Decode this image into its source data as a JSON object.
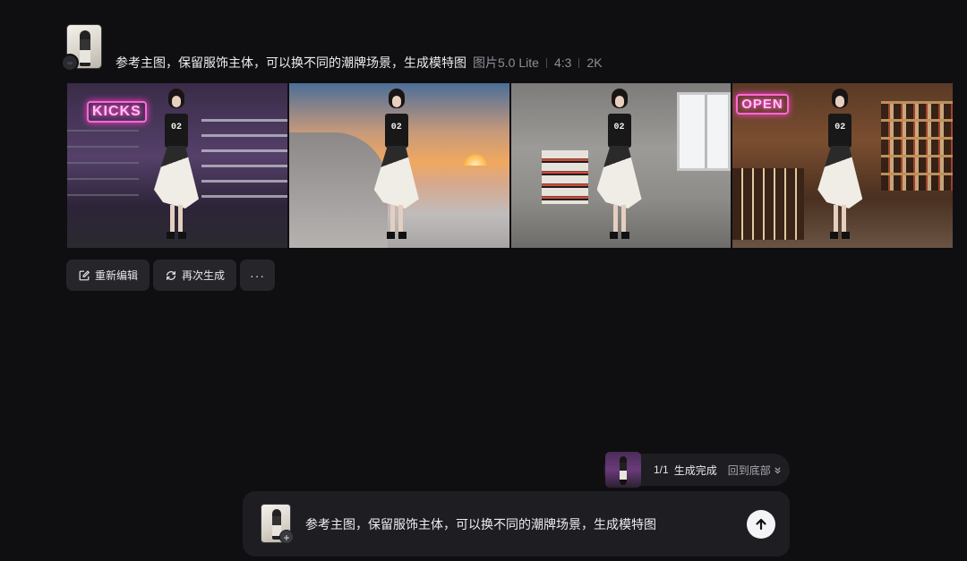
{
  "prompt": {
    "text": "参考主图，保留服饰主体，可以换不同的潮牌场景，生成模特图",
    "model": "图片5.0 Lite",
    "ratio": "4:3",
    "resolution": "2K"
  },
  "images": [
    {
      "neon_sign": "KICKS",
      "jersey": "02"
    },
    {
      "neon_sign": "",
      "jersey": "02"
    },
    {
      "neon_sign": "",
      "jersey": "02"
    },
    {
      "neon_sign": "OPEN",
      "jersey": "02"
    }
  ],
  "actions": {
    "reedit_label": "重新编辑",
    "regenerate_label": "再次生成",
    "more_label": "···"
  },
  "status": {
    "count": "1/1",
    "done_label": "生成完成",
    "back_to_bottom": "回到底部"
  },
  "composer": {
    "text": "参考主图，保留服饰主体，可以换不同的潮牌场景，生成模特图",
    "add_label": "+"
  }
}
